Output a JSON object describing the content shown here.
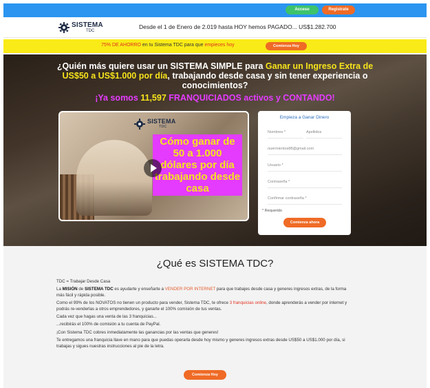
{
  "topbar": {
    "login_label": "Acceso",
    "register_label": "Registrate"
  },
  "header": {
    "logo_name": "SISTEMA",
    "logo_sub": "TDC",
    "paid_text": "Desde el 1 de Enero de 2.019 hasta HOY hemos PAGADO...",
    "paid_amount": "US$1.282.700"
  },
  "promo": {
    "discount": "75% DE AHORRO",
    "text_mid": " en tu Sistema TDC para que ",
    "text_red": "empieces hoy",
    "button_label": "Comienza Hoy"
  },
  "hero": {
    "headline_pre": "¿Quién más quiere usar un SISTEMA SIMPLE para ",
    "headline_highlight": "Ganar un Ingreso Extra de US$50 a US$1.000 por día",
    "headline_post": ", trabajando desde casa y sin tener experiencia o conocimientos?",
    "count_pre": "¡Ya somos ",
    "count_number": "11,597",
    "count_post": " FRANQUICIADOS activos y CONTANDO!",
    "video_logo_name": "SISTEMA",
    "video_logo_sub": "TDC",
    "video_title": "Cómo ganar de 50 a 1.000 dólares por día trabajando desde casa"
  },
  "form": {
    "title": "Empieza a Ganar Dinero",
    "fields": {
      "nombres": "Nombres *",
      "apellidos": "Apellidos",
      "email": "nuermientos88@gmail.com",
      "usuario": "Usuario *",
      "contrasena": "Contraseña *",
      "confirmar": "Confirmar contraseña *"
    },
    "required_note": "* Requerido",
    "button_label": "Comienza ahora"
  },
  "about": {
    "title": "¿Qué es SISTEMA TDC?",
    "line1": "TDC = Trabajar Desde Casa",
    "p2_a": "La ",
    "p2_b": "MISIÓN",
    "p2_c": " de ",
    "p2_d": "SISTEMA TDC",
    "p2_e": " es ayudarte y enseñarte a ",
    "p2_f": "VENDER POR INTERNET",
    "p2_g": " para que trabajes desde casa y generes ingresos extras, de la forma más fácil y rápida posible.",
    "p3_a": "Como el 99% de los NOVATOS no tienen un producto para vender, Sistema TDC, te ofrece ",
    "p3_b": "3 franquicias online",
    "p3_c": ", donde aprenderás a vender por internet y podrás re-venderlas a otros emprendedores, y ganarte el 100% comisión de tus ventas.",
    "p4": "Cada vez que hagas una venta de las 3 franquicias...",
    "p5": "...recibirás el 100% de comisión a tu cuenta de PayPal.",
    "p6": "¡Con Sistema TDC cobres inmediatamente las ganancias por las ventas que generes!",
    "p7": "Te entregamos una franquicia llave en mano para que puedas operarla desde hoy mismo y generes ingresos extras desde US$50 a US$1.000 por día, si trabajas y sigues nuestras instrucciones al pie de la letra.",
    "button_label": "Comienza Hoy"
  },
  "colors": {
    "topbar": "#2b95f0",
    "accent_orange": "#ef6b26",
    "accent_green": "#3cc36b",
    "promo_yellow": "#f9eb17",
    "magenta": "#e43bff"
  }
}
